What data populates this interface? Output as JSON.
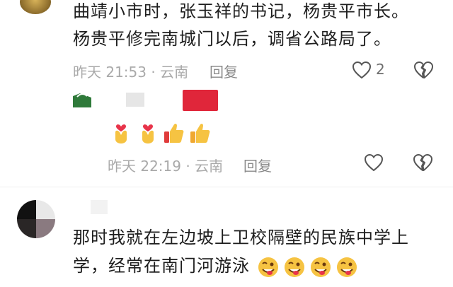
{
  "comment1": {
    "line1": "曲靖小市时，张玉祥的书记，杨贵平市长。",
    "line2": "杨贵平修完南城门以后，调省公路局了。",
    "meta": "昨天 21:53 · 云南",
    "reply": "回复",
    "like_count": "2"
  },
  "comment1_reply": {
    "meta": "昨天 22:19 · 云南",
    "reply": "回复",
    "emoji_icons": [
      "heart-hands-icon",
      "heart-hands-icon",
      "thumbs-up-icon",
      "thumbs-up-icon"
    ]
  },
  "comment2": {
    "line1": "那时我就在左边坡上卫校隔壁的民族中学上",
    "line2": "学，经常在南门河游泳",
    "emoji_icons": [
      "wink-tongue-icon",
      "wink-tongue-icon",
      "wink-tongue-icon",
      "wink-tongue-icon"
    ]
  },
  "colors": {
    "meta": "#a9a9a9",
    "text": "#1e1e1e",
    "redacted_red": "#e0263a",
    "redacted_green": "#2f7a3a"
  }
}
